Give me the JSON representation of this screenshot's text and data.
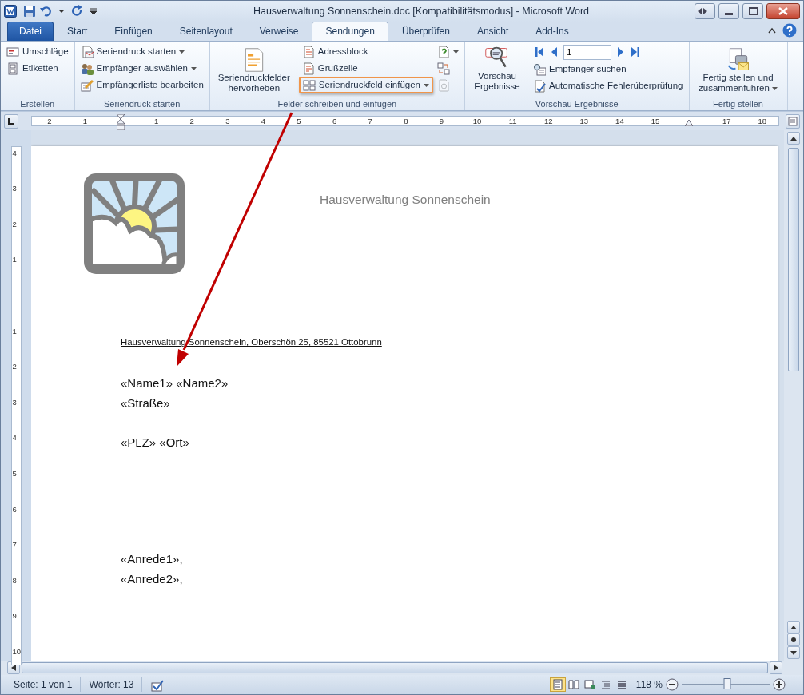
{
  "window": {
    "title": "Hausverwaltung Sonnenschein.doc [Kompatibilitätsmodus]  -  Microsoft Word"
  },
  "tabs": [
    {
      "label": "Datei",
      "kind": "file",
      "selected": false
    },
    {
      "label": "Start",
      "kind": "tab",
      "selected": false
    },
    {
      "label": "Einfügen",
      "kind": "tab",
      "selected": false
    },
    {
      "label": "Seitenlayout",
      "kind": "tab",
      "selected": false
    },
    {
      "label": "Verweise",
      "kind": "tab",
      "selected": false
    },
    {
      "label": "Sendungen",
      "kind": "tab",
      "selected": true
    },
    {
      "label": "Überprüfen",
      "kind": "tab",
      "selected": false
    },
    {
      "label": "Ansicht",
      "kind": "tab",
      "selected": false
    },
    {
      "label": "Add-Ins",
      "kind": "tab",
      "selected": false
    }
  ],
  "ribbon": {
    "groups": [
      {
        "label": "Erstellen",
        "columns": [
          [
            {
              "kind": "small",
              "label": "Umschläge",
              "dropdown": false,
              "highlighted": false,
              "disabled": false
            },
            {
              "kind": "small",
              "label": "Etiketten",
              "dropdown": false,
              "highlighted": false,
              "disabled": false
            }
          ]
        ]
      },
      {
        "label": "Seriendruck starten",
        "columns": [
          [
            {
              "kind": "small",
              "label": "Seriendruck starten",
              "dropdown": true,
              "highlighted": false,
              "disabled": false
            },
            {
              "kind": "small",
              "label": "Empfänger auswählen",
              "dropdown": true,
              "highlighted": false,
              "disabled": false
            },
            {
              "kind": "small",
              "label": "Empfängerliste bearbeiten",
              "dropdown": false,
              "highlighted": false,
              "disabled": false
            }
          ]
        ]
      },
      {
        "label": "Felder schreiben und einfügen",
        "columns": [
          [
            {
              "kind": "large",
              "label": "Seriendruckfelder hervorheben",
              "dropdown": false,
              "highlighted": false,
              "disabled": false
            }
          ],
          [
            {
              "kind": "small",
              "label": "Adressblock",
              "dropdown": false,
              "highlighted": false,
              "disabled": false
            },
            {
              "kind": "small",
              "label": "Grußzeile",
              "dropdown": false,
              "highlighted": false,
              "disabled": false
            },
            {
              "kind": "small",
              "label": "Seriendruckfeld einfügen",
              "dropdown": true,
              "highlighted": true,
              "disabled": false
            }
          ],
          [
            {
              "kind": "icon",
              "dropdown": true,
              "highlighted": false,
              "disabled": false
            },
            {
              "kind": "icon",
              "dropdown": false,
              "highlighted": false,
              "disabled": false
            },
            {
              "kind": "icon",
              "dropdown": false,
              "highlighted": false,
              "disabled": true
            }
          ]
        ]
      },
      {
        "label": "Vorschau Ergebnisse",
        "columns": [
          [
            {
              "kind": "large",
              "label": "Vorschau Ergebnisse",
              "dropdown": false,
              "highlighted": false,
              "disabled": false
            }
          ],
          [
            {
              "kind": "nav",
              "value": "1"
            },
            {
              "kind": "small",
              "label": "Empfänger suchen",
              "dropdown": false,
              "highlighted": false,
              "disabled": false
            },
            {
              "kind": "small",
              "label": "Automatische Fehlerüberprüfung",
              "dropdown": false,
              "highlighted": false,
              "disabled": false
            }
          ]
        ]
      },
      {
        "label": "Fertig stellen",
        "columns": [
          [
            {
              "kind": "large",
              "label": "Fertig stellen und zusammenführen",
              "dropdown": true,
              "highlighted": false,
              "disabled": false
            }
          ]
        ]
      }
    ]
  },
  "ruler": {
    "labels": [
      "2",
      "1",
      "1",
      "2",
      "3",
      "4",
      "5",
      "6",
      "7",
      "8",
      "9",
      "10",
      "11",
      "12",
      "13",
      "14",
      "15",
      "17",
      "18"
    ]
  },
  "vertical_ruler": {
    "labels": [
      "4",
      "3",
      "2",
      "1",
      "1",
      "2",
      "3",
      "4",
      "5",
      "6",
      "7",
      "8",
      "9",
      "10"
    ]
  },
  "document": {
    "header_title": "Hausverwaltung Sonnenschein",
    "sender_line": "Hausverwaltung Sonnenschein, Oberschön 25, 85521 Ottobrunn",
    "address_blocks": [
      [
        "«Name1» «Name2»",
        "«Straße»"
      ],
      [
        "«PLZ» «Ort»"
      ]
    ],
    "salutation_lines": [
      "«Anrede1»,",
      "«Anrede2»,"
    ]
  },
  "status_bar": {
    "page": "Seite: 1 von 1",
    "words": "Wörter: 13",
    "views": [
      {
        "selected": true
      },
      {
        "selected": false
      },
      {
        "selected": false
      },
      {
        "selected": false
      },
      {
        "selected": false
      }
    ],
    "zoom": "118 %",
    "zoom_slider": {
      "level": 0.52
    }
  }
}
